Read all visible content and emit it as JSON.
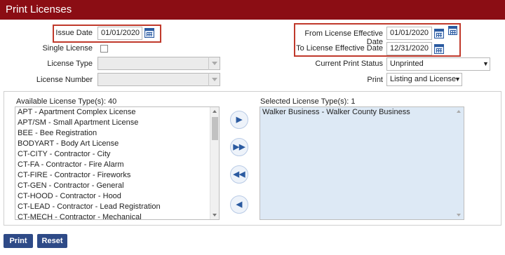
{
  "header": {
    "title": "Print Licenses"
  },
  "issue_date": {
    "label": "Issue Date",
    "value": "01/01/2020"
  },
  "single_license": {
    "label": "Single License",
    "checked": false
  },
  "license_type": {
    "label": "License Type",
    "value": ""
  },
  "license_number": {
    "label": "License Number",
    "value": ""
  },
  "from_effective": {
    "label": "From License Effective Date",
    "value": "01/01/2020"
  },
  "to_effective": {
    "label": "To License Effective Date",
    "value": "12/31/2020"
  },
  "print_status": {
    "label": "Current Print Status",
    "value": "Unprinted"
  },
  "print_option": {
    "label": "Print",
    "value": "Listing and License"
  },
  "available": {
    "label": "Available License Type(s): 40",
    "items": [
      "APT - Apartment Complex License",
      "APT/SM - Small Apartment License",
      "BEE - Bee Registration",
      "BODYART - Body Art License",
      "CT-CITY - Contractor - City",
      "CT-FA - Contractor - Fire Alarm",
      "CT-FIRE - Contractor - Fireworks",
      "CT-GEN - Contractor - General",
      "CT-HOOD - Contractor - Hood",
      "CT-LEAD - Contractor - Lead Registration",
      "CT-MECH - Contractor - Mechanical"
    ]
  },
  "selected": {
    "label": "Selected License Type(s): 1",
    "items": [
      "Walker Business - Walker County Business"
    ]
  },
  "buttons": {
    "print": "Print",
    "reset": "Reset"
  },
  "icons": {
    "move_one_right": "triangle-right",
    "move_all_right": "double-triangle-right",
    "move_all_left": "double-triangle-left",
    "move_one_left": "triangle-left"
  },
  "colors": {
    "header": "#8b0d14",
    "button": "#2e4a87",
    "highlight": "#c0392b"
  }
}
